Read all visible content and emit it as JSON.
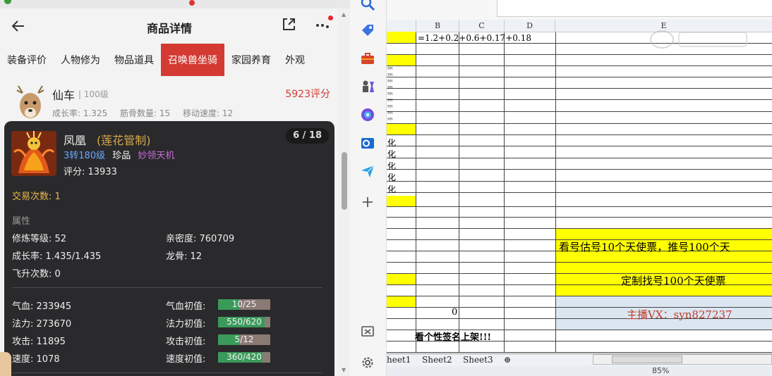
{
  "app": {
    "title": "商品详情",
    "tabs": [
      "装备评价",
      "人物修为",
      "物品道具",
      "召唤兽坐骑",
      "家园养育",
      "外观"
    ],
    "active_tab": "召唤兽坐骑",
    "item": {
      "name": "仙车",
      "level": "| 100级",
      "score": "5923评分",
      "stats": [
        "成长率: 1.325",
        "筋骨数量: 15",
        "移动速度: 12"
      ]
    }
  },
  "popup": {
    "name": "凤凰",
    "subtitle": "(莲花管制)",
    "counter": "6 / 18",
    "level": "3转180级",
    "rarity": "珍品",
    "server": "妙领天机",
    "score": "评分: 13933",
    "trade_count": "交易次数: 1",
    "attr_title": "属性",
    "attrs": {
      "cultivation": "修炼等级: 52",
      "intimacy": "亲密度: 760709",
      "growth": "成长率: 1.435/1.435",
      "dragon_bone": "龙骨: 12",
      "ascension": "飞升次数: 0",
      "hp": "气血: 233945",
      "mp": "法力: 273670",
      "atk": "攻击: 11895",
      "spd": "速度: 1078",
      "hp_init_label": "气血初值:",
      "mp_init_label": "法力初值:",
      "atk_init_label": "攻击初值:",
      "spd_init_label": "速度初值:"
    },
    "init_bars": [
      {
        "key": "hp",
        "text": "10/25",
        "value": 10,
        "max": 25
      },
      {
        "key": "mp",
        "text": "550/620",
        "value": 550,
        "max": 620
      },
      {
        "key": "atk",
        "text": "5/12",
        "value": 5,
        "max": 12
      },
      {
        "key": "spd",
        "text": "360/420",
        "value": 360,
        "max": 420
      }
    ]
  },
  "sidebar": {
    "icons": [
      "search-icon",
      "tag-icon",
      "toolbox-icon",
      "chess-icon",
      "circle-app-icon",
      "outlook-icon",
      "send-icon",
      "add-icon",
      "screenshot-icon",
      "settings-icon"
    ]
  },
  "sheet": {
    "columns": [
      "B",
      "C",
      "D",
      "E"
    ],
    "formula": "=1.2+0.2+0.6+0.17+0.18",
    "colA_text": [
      "化",
      "化",
      "化",
      "化",
      "化"
    ],
    "banner1": "看号估号10个天使票，推号100个天",
    "banner2": "定制找号100个天使票",
    "banner3": "主播VX：syn827237",
    "zero": "0",
    "bottom_text": "看个性签名上架!!!",
    "tabs": [
      "heet1",
      "Sheet2",
      "Sheet3"
    ],
    "zoom": "85%",
    "colors": {
      "yellow": "#ffff00",
      "blue_cell": "#dce6f1",
      "red_text": "#c23a2a"
    }
  }
}
